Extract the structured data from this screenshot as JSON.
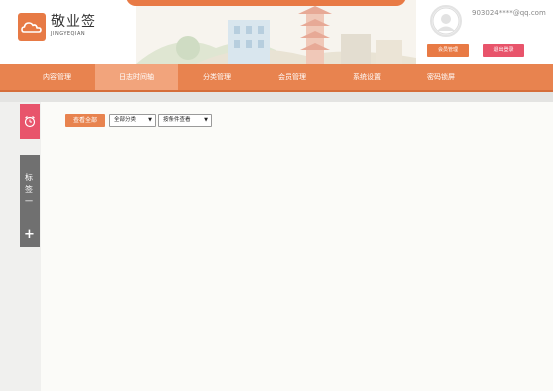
{
  "app": {
    "name": "敬业签",
    "name_sub": "JINGYEQIAN"
  },
  "header": {
    "username": "903024****@qq.com",
    "member_button": "会员管理",
    "logout_button": "退出登录"
  },
  "nav": {
    "items": [
      {
        "label": "内容管理"
      },
      {
        "label": "日志时间轴"
      },
      {
        "label": "分类管理"
      },
      {
        "label": "会员管理"
      },
      {
        "label": "系统设置"
      },
      {
        "label": "密码锁屏"
      }
    ],
    "active_index": 1
  },
  "side": {
    "tag_label": "标签一",
    "plus": "+"
  },
  "toolbar": {
    "view_all_button": "查看全部",
    "category_select": "全部分类",
    "filter_select": "按条件查看"
  },
  "colors": {
    "accent": "#e8834f",
    "danger": "#e8546b",
    "nav_active": "#f2a47c"
  }
}
